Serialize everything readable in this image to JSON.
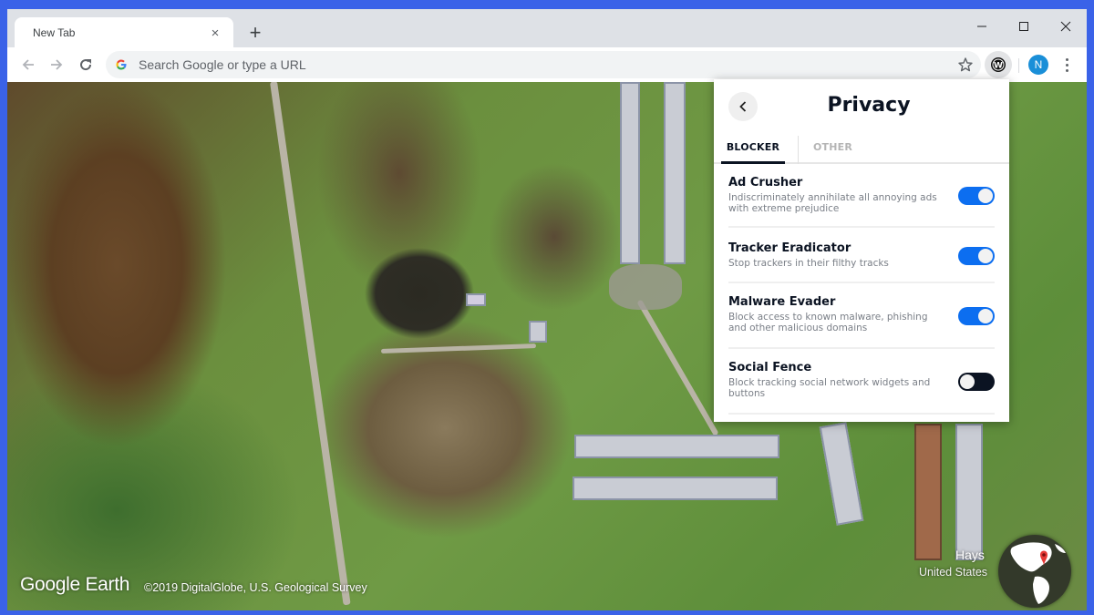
{
  "browser": {
    "tab": {
      "title": "New Tab",
      "close_label": "×"
    },
    "new_tab_label": "+",
    "window_controls": {
      "minimize": "–",
      "maximize": "□",
      "close": "✕"
    },
    "omnibox": {
      "placeholder": "Search Google or type a URL",
      "value": ""
    },
    "profile_initial": "N",
    "extension_icon": "W"
  },
  "map": {
    "logo": "Google Earth",
    "attribution": "©2019 DigitalGlobe, U.S. Geological Survey",
    "location": {
      "name": "Hays",
      "country": "United States"
    }
  },
  "popup": {
    "title": "Privacy",
    "tabs": [
      {
        "label": "BLOCKER",
        "active": true
      },
      {
        "label": "OTHER",
        "active": false
      }
    ],
    "items": [
      {
        "title": "Ad Crusher",
        "description": "Indiscriminately annihilate all annoying ads with extreme prejudice",
        "enabled": true
      },
      {
        "title": "Tracker Eradicator",
        "description": "Stop trackers in their filthy tracks",
        "enabled": true
      },
      {
        "title": "Malware Evader",
        "description": "Block access to known malware, phishing and other malicious domains",
        "enabled": true
      },
      {
        "title": "Social Fence",
        "description": "Block tracking social network widgets and buttons",
        "enabled": false
      }
    ]
  },
  "colors": {
    "frame": "#3a62e8",
    "toggle_on": "#0c6ef0",
    "toggle_off": "#0b1322",
    "avatar": "#1a8fd8"
  }
}
